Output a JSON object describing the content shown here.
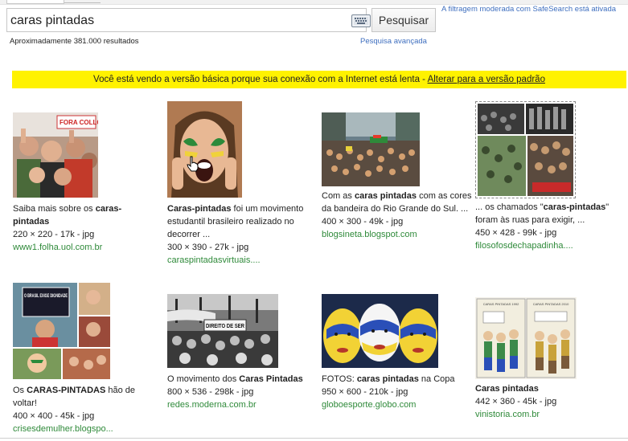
{
  "search": {
    "query": "caras pintadas",
    "button_label": "Pesquisar",
    "safesearch_note": "A filtragem moderada com SafeSearch está ativada"
  },
  "results": {
    "count_text": "Aproximadamente 381.000 resultados",
    "advanced_link": "Pesquisa avançada"
  },
  "banner": {
    "text": "Você está vendo a versão básica porque sua conexão com a Internet está lenta - ",
    "link": "Alterar para a versão padrão"
  },
  "images": [
    {
      "pre": "Saiba mais sobre os ",
      "bold": "caras-pintadas",
      "post": "",
      "dims": "220 × 220 - 17k - jpg",
      "site": "www1.folha.uol.com.br"
    },
    {
      "pre": "",
      "bold": "Caras-pintadas",
      "post": " foi um movimento estudantil brasileiro realizado no decorrer ...",
      "dims": "300 × 390 - 27k - jpg",
      "site": "caraspintadasvirtuais...."
    },
    {
      "pre": "Com as ",
      "bold": "caras pintadas",
      "post": " com as cores da bandeira do Rio Grande do Sul. ...",
      "dims": "400 × 300 - 49k - jpg",
      "site": "blogsineta.blogspot.com"
    },
    {
      "pre": "... os chamados \"",
      "bold": "caras-pintadas",
      "post": "\" foram às ruas para exigir, ...",
      "dims": "450 × 428 - 99k - jpg",
      "site": "filosofosdechapadinha...."
    },
    {
      "pre": "Os ",
      "bold": "CARAS-PINTADAS",
      "post": " hão de voltar!",
      "dims": "400 × 400 - 45k - jpg",
      "site": "crisesdemulher.blogspo..."
    },
    {
      "pre": "O movimento dos ",
      "bold": "Caras Pintadas",
      "post": "",
      "dims": "800 × 536 - 298k - jpg",
      "site": "redes.moderna.com.br"
    },
    {
      "pre": "FOTOS: ",
      "bold": "caras pintadas",
      "post": " na Copa",
      "dims": "950 × 600 - 210k - jpg",
      "site": "globoesporte.globo.com"
    },
    {
      "pre": "",
      "bold": "Caras pintadas",
      "post": "",
      "dims": "442 × 360 - 45k - jpg",
      "site": "vinistoria.com.br"
    }
  ],
  "image_text": {
    "protest_sign_1": "FORA COLLOR",
    "protest_sign_5": "O BRASIL EXIGE DIGNIDADE",
    "protest_sign_6": "DIREITO DE SER",
    "comic_title_a": "CARAS PINTADAS 1992",
    "comic_title_b": "CARAS PINTADAS 2010"
  },
  "colors": {
    "link_blue": "#3f6fbf",
    "site_green": "#2f8a3a",
    "banner_yellow": "#fff200"
  },
  "icons": [
    "keyboard-icon",
    "hand-cursor-icon"
  ]
}
